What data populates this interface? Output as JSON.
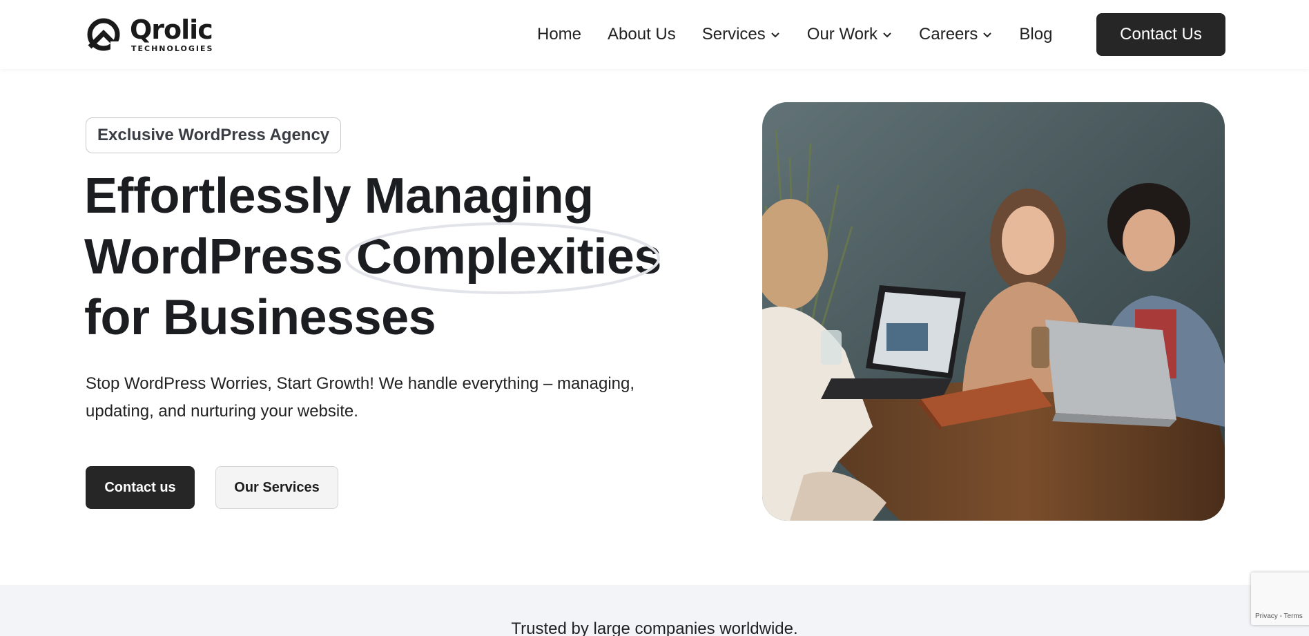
{
  "header": {
    "logo": {
      "name": "Qrolic",
      "tagline": "TECHNOLOGIES"
    },
    "nav": [
      {
        "label": "Home",
        "dropdown": false
      },
      {
        "label": "About Us",
        "dropdown": false
      },
      {
        "label": "Services",
        "dropdown": true
      },
      {
        "label": "Our Work",
        "dropdown": true
      },
      {
        "label": "Careers",
        "dropdown": true
      },
      {
        "label": "Blog",
        "dropdown": false
      }
    ],
    "cta_label": "Contact Us"
  },
  "hero": {
    "badge": "Exclusive WordPress Agency",
    "headline": {
      "line1": "Effortlessly Managing",
      "line2_prefix": "WordPress ",
      "line2_highlight": "Complexities",
      "line3": "for Businesses"
    },
    "subtext_line1": "Stop WordPress Worries, Start Growth! We handle everything – managing,",
    "subtext_line2": "updating, and nurturing your website.",
    "primary_button": "Contact us",
    "secondary_button": "Our Services",
    "image_icon": "team-meeting-photo"
  },
  "trusted": {
    "text": "Trusted by large companies worldwide."
  },
  "recaptcha": {
    "privacy": "Privacy",
    "separator": " - ",
    "terms": "Terms"
  },
  "colors": {
    "dark_button": "#262626",
    "text": "#1f2023",
    "strip_bg": "#f3f4f7",
    "highlight_ellipse": "#e3e4ea"
  }
}
